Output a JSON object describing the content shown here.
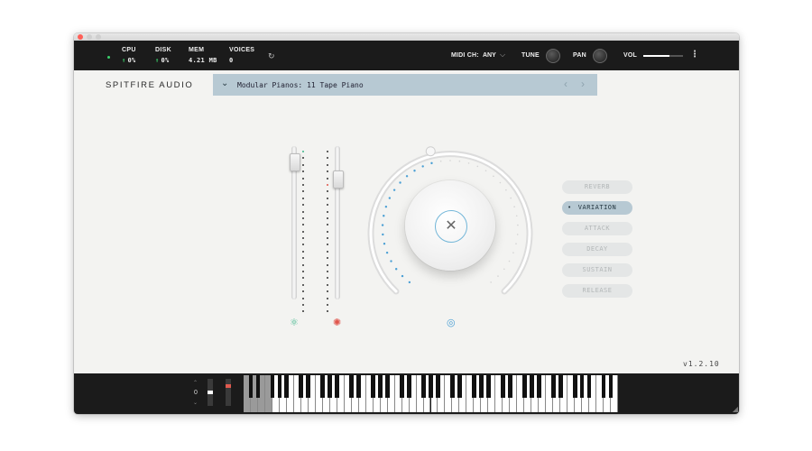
{
  "window": {
    "traffic_lights": [
      "close",
      "minimize",
      "zoom"
    ]
  },
  "stats": {
    "cpu": {
      "label": "CPU",
      "value": "0%",
      "arrow": "↑"
    },
    "disk": {
      "label": "DISK",
      "value": "0%",
      "arrow": "↑"
    },
    "mem": {
      "label": "MEM",
      "value": "4.21 MB"
    },
    "voices": {
      "label": "VOICES",
      "value": "0"
    },
    "refresh_icon": "↻"
  },
  "topbar": {
    "midi_label": "MIDI CH:",
    "midi_value": "ANY",
    "midi_chevron": "⌵",
    "tune_label": "TUNE",
    "pan_label": "PAN",
    "vol_label": "VOL",
    "vol_level": 0.65,
    "menu_icon": "⋮"
  },
  "brand": "SPITFIRE AUDIO",
  "preset": {
    "caret": "⌄",
    "name": "Modular Pianos: 11 Tape Piano",
    "prev": "‹",
    "next": "›"
  },
  "faders": {
    "fader1_level": 0.95,
    "fader2_level": 0.82
  },
  "fader_icons": {
    "left": "⚛",
    "right": "✺",
    "dial": "◎"
  },
  "dial": {
    "knob_symbol": "✕",
    "value_fraction": 0.45,
    "accent_color": "#4a9fd4"
  },
  "envelope_buttons": [
    {
      "label": "REVERB",
      "active": false
    },
    {
      "label": "VARIATION",
      "active": true
    },
    {
      "label": "ATTACK",
      "active": false
    },
    {
      "label": "DECAY",
      "active": false
    },
    {
      "label": "SUSTAIN",
      "active": false
    },
    {
      "label": "RELEASE",
      "active": false
    }
  ],
  "active_bullet": "•",
  "version": "v1.2.10",
  "keyboard": {
    "octave_value": "0",
    "octave_up": "⌃",
    "octave_down": "⌄",
    "resize_icon": "◢"
  }
}
